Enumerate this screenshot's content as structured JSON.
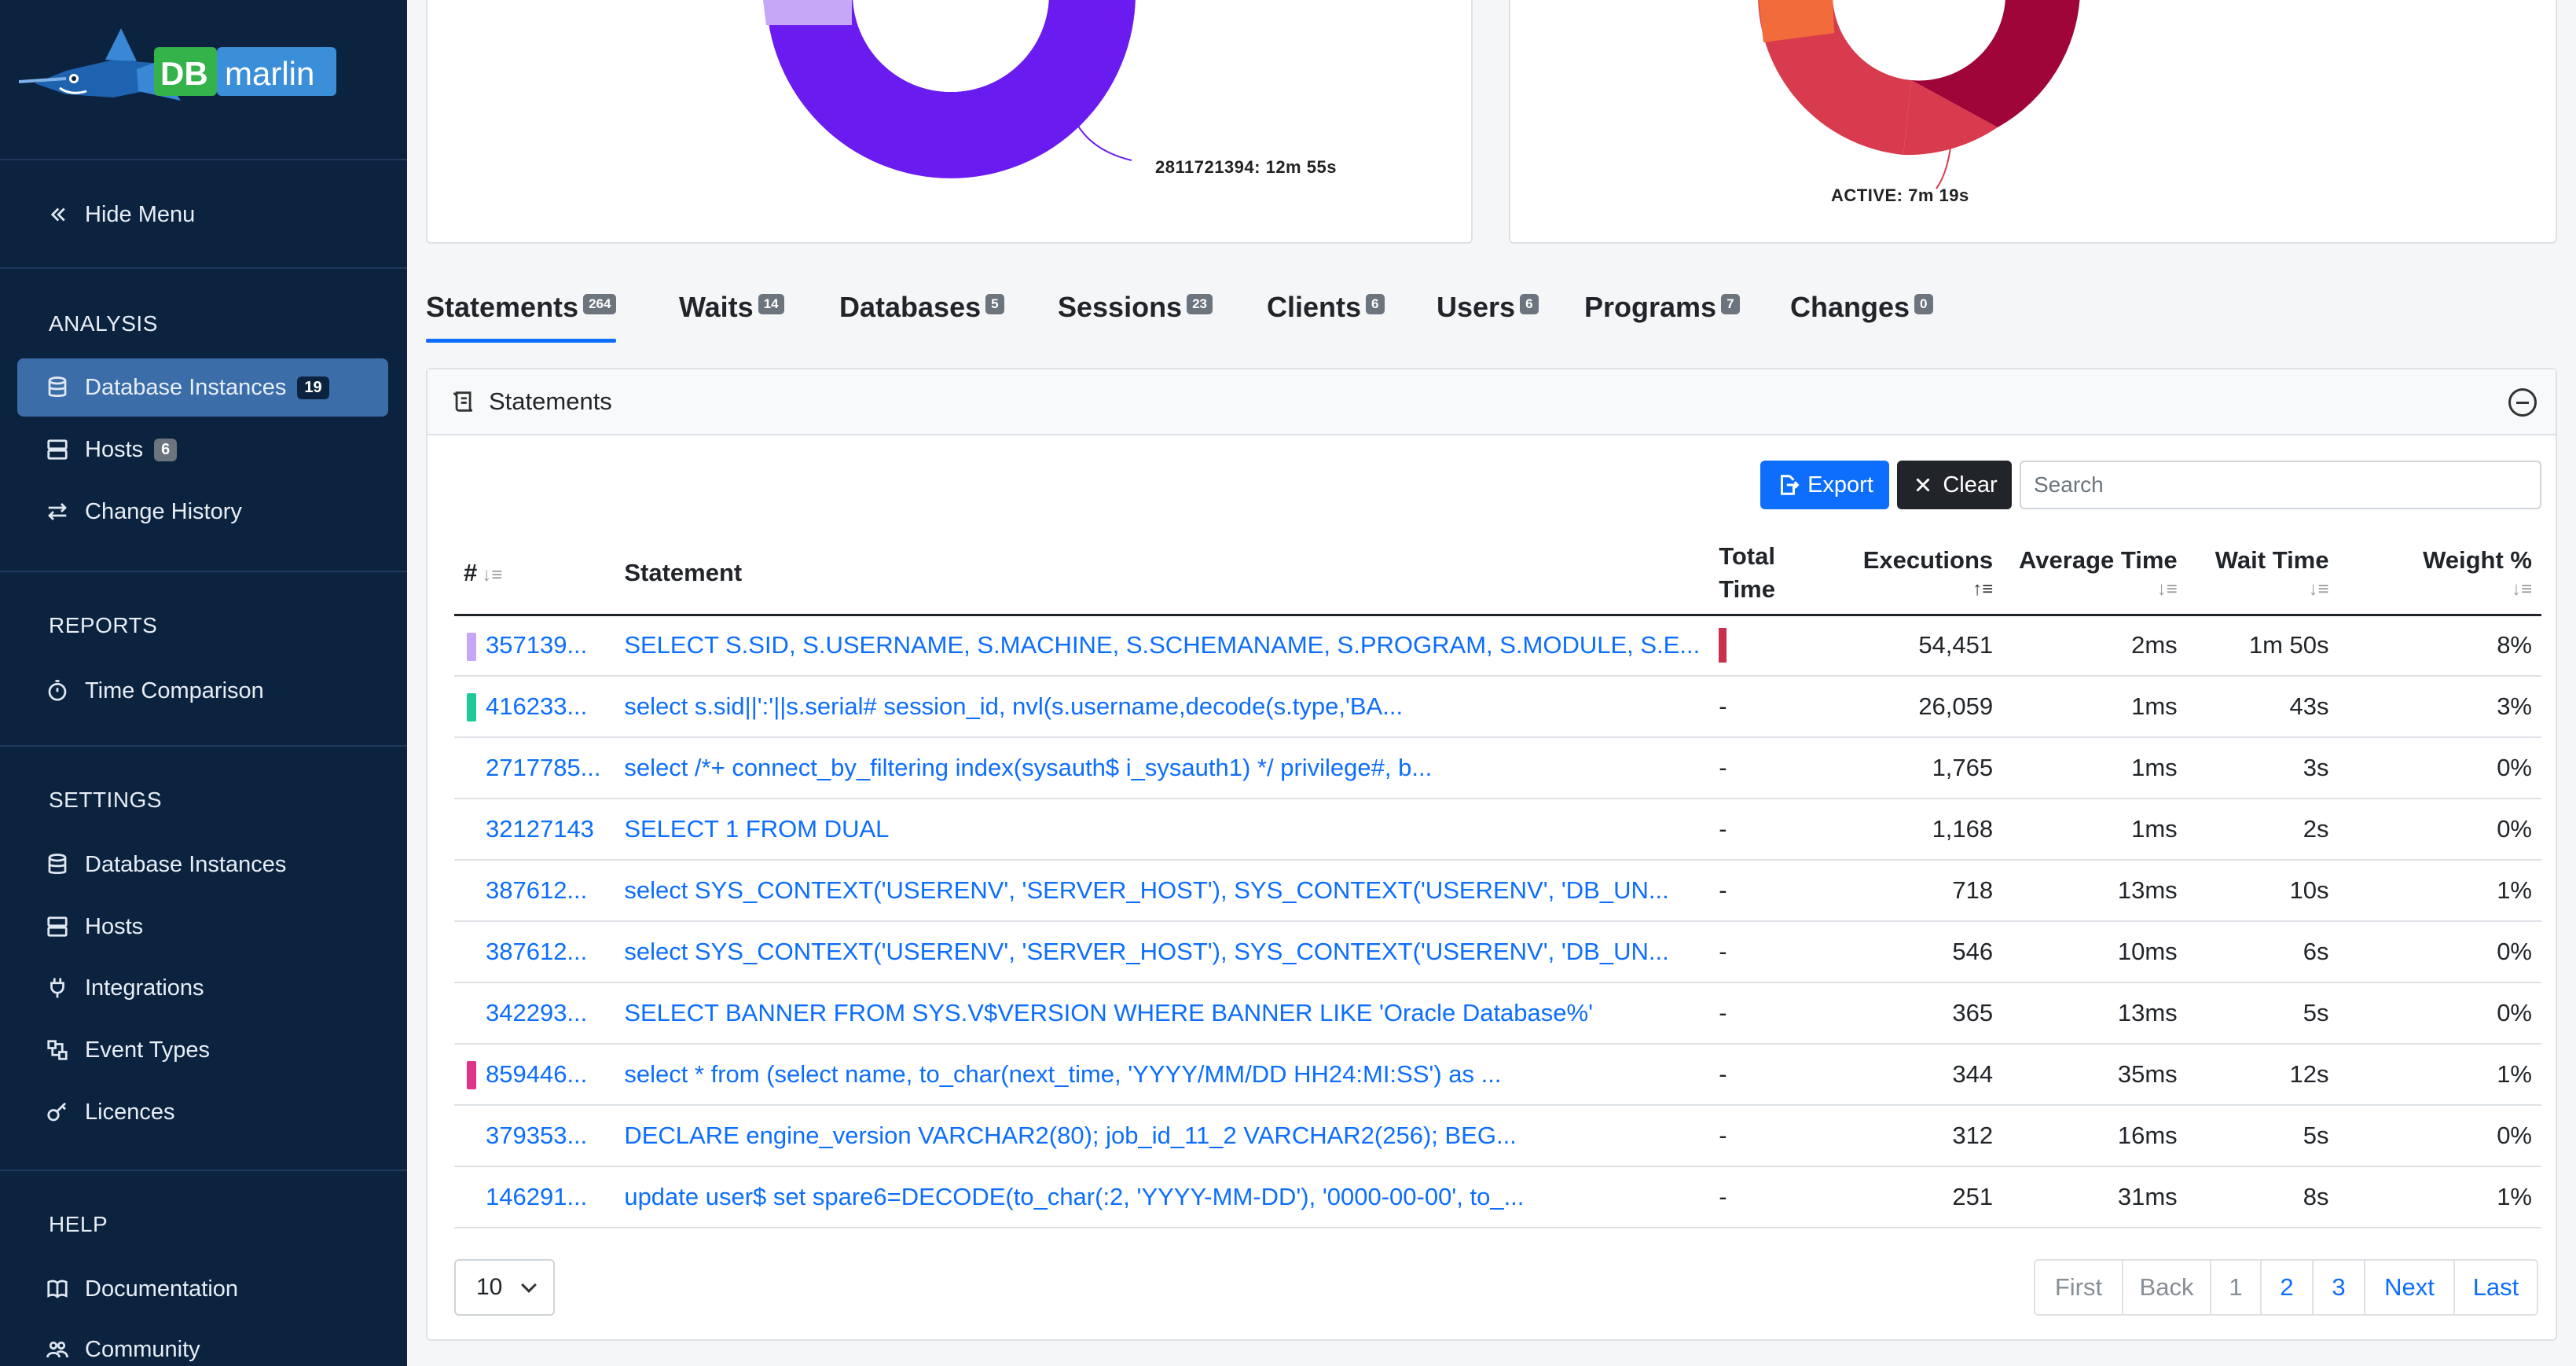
{
  "app": {
    "brand_logo_text": "DB marlin"
  },
  "sidebar": {
    "hide_menu": "Hide Menu",
    "sections": {
      "analysis": "ANALYSIS",
      "reports": "REPORTS",
      "settings": "SETTINGS",
      "help": "HELP"
    },
    "analysis_items": [
      {
        "label": "Database Instances",
        "badge": "19",
        "icon": "database-icon",
        "active": true
      },
      {
        "label": "Hosts",
        "badge": "6",
        "icon": "server-icon"
      },
      {
        "label": "Change History",
        "icon": "arrows-exchange-icon"
      }
    ],
    "reports_items": [
      {
        "label": "Time Comparison",
        "icon": "stopwatch-icon"
      }
    ],
    "settings_items": [
      {
        "label": "Database Instances",
        "icon": "database-icon"
      },
      {
        "label": "Hosts",
        "icon": "server-icon"
      },
      {
        "label": "Integrations",
        "icon": "plug-icon"
      },
      {
        "label": "Event Types",
        "icon": "event-types-icon"
      },
      {
        "label": "Licences",
        "icon": "key-icon"
      }
    ],
    "help_items": [
      {
        "label": "Documentation",
        "icon": "book-icon"
      },
      {
        "label": "Community",
        "icon": "people-icon"
      }
    ]
  },
  "donuts": {
    "left_label": "2811721394: 12m 55s",
    "right_label": "ACTIVE: 7m 19s",
    "colors": {
      "purple": "#6a1bf0",
      "lavender": "#c6a6f7",
      "red": "#d93b4e",
      "crimson": "#a0053a",
      "orange": "#f26b3a"
    }
  },
  "tabs": [
    {
      "label": "Statements",
      "badge": "264",
      "active": true
    },
    {
      "label": "Waits",
      "badge": "14"
    },
    {
      "label": "Databases",
      "badge": "5"
    },
    {
      "label": "Sessions",
      "badge": "23"
    },
    {
      "label": "Clients",
      "badge": "6"
    },
    {
      "label": "Users",
      "badge": "6"
    },
    {
      "label": "Programs",
      "badge": "7"
    },
    {
      "label": "Changes",
      "badge": "0"
    }
  ],
  "statements": {
    "title": "Statements",
    "export_label": "Export",
    "clear_label": "Clear",
    "search_placeholder": "Search",
    "columns": {
      "hash": "#",
      "statement": "Statement",
      "total_time_1": "Total",
      "total_time_2": "Time",
      "executions": "Executions",
      "avg_time": "Average Time",
      "wait_time": "Wait Time",
      "weight": "Weight %"
    },
    "rows": [
      {
        "id": "357139...",
        "statement": "SELECT S.SID, S.USERNAME, S.MACHINE, S.SCHEMANAME, S.PROGRAM, S.MODULE, S.E...",
        "total": "",
        "executions": "54,451",
        "avg": "2ms",
        "wait": "1m 50s",
        "weight": "8%",
        "marker": "#c6a6f7",
        "bar": true
      },
      {
        "id": "416233...",
        "statement": "select s.sid||':'||s.serial# session_id, nvl(s.username,decode(s.type,'BA...",
        "total": "-",
        "executions": "26,059",
        "avg": "1ms",
        "wait": "43s",
        "weight": "3%",
        "marker": "#20c997"
      },
      {
        "id": "2717785...",
        "statement": "select /*+ connect_by_filtering index(sysauth$ i_sysauth1) */ privilege#, b...",
        "total": "-",
        "executions": "1,765",
        "avg": "1ms",
        "wait": "3s",
        "weight": "0%"
      },
      {
        "id": "32127143",
        "statement": "SELECT 1 FROM DUAL",
        "total": "-",
        "executions": "1,168",
        "avg": "1ms",
        "wait": "2s",
        "weight": "0%"
      },
      {
        "id": "387612...",
        "statement": "select SYS_CONTEXT('USERENV', 'SERVER_HOST'), SYS_CONTEXT('USERENV', 'DB_UN...",
        "total": "-",
        "executions": "718",
        "avg": "13ms",
        "wait": "10s",
        "weight": "1%"
      },
      {
        "id": "387612...",
        "statement": "select SYS_CONTEXT('USERENV', 'SERVER_HOST'), SYS_CONTEXT('USERENV', 'DB_UN...",
        "total": "-",
        "executions": "546",
        "avg": "10ms",
        "wait": "6s",
        "weight": "0%"
      },
      {
        "id": "342293...",
        "statement": "SELECT BANNER FROM SYS.V$VERSION WHERE BANNER LIKE 'Oracle Database%'",
        "total": "-",
        "executions": "365",
        "avg": "13ms",
        "wait": "5s",
        "weight": "0%"
      },
      {
        "id": "859446...",
        "statement": "select * from (select name, to_char(next_time, 'YYYY/MM/DD HH24:MI:SS') as ...",
        "total": "-",
        "executions": "344",
        "avg": "35ms",
        "wait": "12s",
        "weight": "1%",
        "marker": "#e0338a"
      },
      {
        "id": "379353...",
        "statement": "DECLARE engine_version VARCHAR2(80); job_id_11_2 VARCHAR2(256); BEG...",
        "total": "-",
        "executions": "312",
        "avg": "16ms",
        "wait": "5s",
        "weight": "0%"
      },
      {
        "id": "146291...",
        "statement": "update user$ set spare6=DECODE(to_char(:2, 'YYYY-MM-DD'), '0000-00-00', to_...",
        "total": "-",
        "executions": "251",
        "avg": "31ms",
        "wait": "8s",
        "weight": "1%"
      }
    ],
    "page_size": "10",
    "pagination": [
      "First",
      "Back",
      "1",
      "2",
      "3",
      "Next",
      "Last"
    ]
  }
}
